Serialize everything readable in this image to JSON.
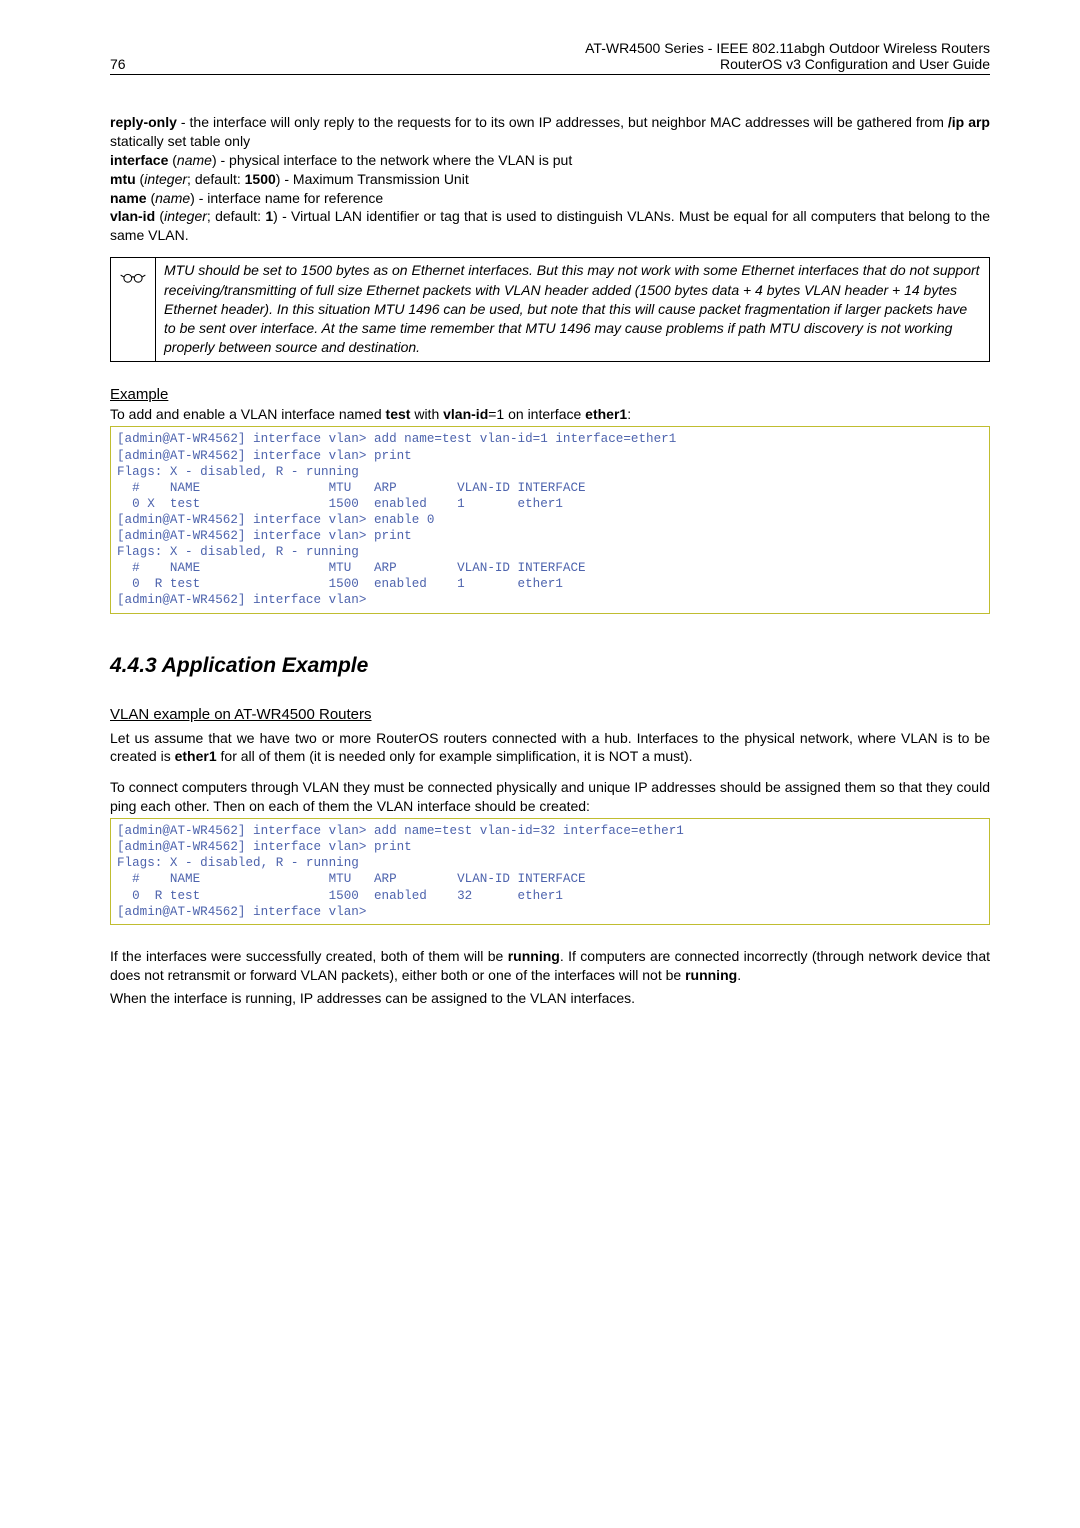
{
  "header": {
    "page_num": "76",
    "title1": "AT-WR4500 Series - IEEE 802.11abgh Outdoor Wireless Routers",
    "title2": "RouterOS v3 Configuration and User Guide"
  },
  "defs": {
    "reply_only_label": "reply-only",
    "reply_only_text": " - the interface will only reply to the requests for to its own IP addresses, but neighbor MAC addresses will be gathered from ",
    "reply_only_cmd": "/ip arp",
    "reply_only_tail": " statically set table only",
    "interface_label": "interface",
    "interface_type": "name",
    "interface_text": ") - physical interface to the network where the VLAN is put",
    "mtu_label": "mtu",
    "mtu_type": "integer",
    "mtu_default": "1500",
    "mtu_text": ") - Maximum Transmission Unit",
    "name_label": "name",
    "name_type": "name",
    "name_text": ") - interface name for reference",
    "vlanid_label": "vlan-id",
    "vlanid_type": "integer",
    "vlanid_default": "1",
    "vlanid_text": ") - Virtual LAN identifier or tag that is used to distinguish VLANs. Must be equal for all computers that belong to the same VLAN."
  },
  "note": {
    "text": "MTU should be set to 1500 bytes as on Ethernet interfaces. But this may not work with some Ethernet interfaces that do not support receiving/transmitting of full size Ethernet packets with VLAN header added (1500 bytes data + 4 bytes VLAN header + 14 bytes Ethernet header). In this situation MTU 1496 can be used, but note that this will cause packet fragmentation if larger packets have to be sent over interface. At the same time remember that MTU 1496 may cause problems if path MTU discovery is not working properly between source and destination."
  },
  "example": {
    "heading": "Example",
    "intro_pre": "To add and enable a VLAN interface named ",
    "intro_name": "test",
    "intro_mid": " with ",
    "intro_vlan": "vlan-id",
    "intro_eq": "=1 on interface ",
    "intro_iface": "ether1",
    "intro_colon": ":",
    "code": "[admin@AT-WR4562] interface vlan> add name=test vlan-id=1 interface=ether1\n[admin@AT-WR4562] interface vlan> print\nFlags: X - disabled, R - running\n  #    NAME                 MTU   ARP        VLAN-ID INTERFACE\n  0 X  test                 1500  enabled    1       ether1\n[admin@AT-WR4562] interface vlan> enable 0\n[admin@AT-WR4562] interface vlan> print\nFlags: X - disabled, R - running\n  #    NAME                 MTU   ARP        VLAN-ID INTERFACE\n  0  R test                 1500  enabled    1       ether1\n[admin@AT-WR4562] interface vlan>"
  },
  "app_example": {
    "heading": "4.4.3 Application Example",
    "sub_heading": "VLAN example on AT-WR4500 Routers",
    "p1a": "Let us assume that we have two or more RouterOS routers connected with a hub. Interfaces to the physical network, where VLAN is to be created is ",
    "p1b": "ether1",
    "p1c": " for all of them (it is needed only for example simplification, it is NOT a must).",
    "p2": "To connect computers through VLAN they must be connected physically and unique IP addresses should be assigned them so that they could ping each other. Then on each of them the VLAN interface should be created:",
    "code": "[admin@AT-WR4562] interface vlan> add name=test vlan-id=32 interface=ether1\n[admin@AT-WR4562] interface vlan> print\nFlags: X - disabled, R - running\n  #    NAME                 MTU   ARP        VLAN-ID INTERFACE\n  0  R test                 1500  enabled    32      ether1\n[admin@AT-WR4562] interface vlan>",
    "p3a": "If the interfaces were successfully created, both of them will be ",
    "p3b": "running",
    "p3c": ". If computers are connected incorrectly (through network device that does not retransmit or forward VLAN packets), either both or one of the interfaces will not be ",
    "p3d": "running",
    "p3e": ".",
    "p4": "When the interface is running, IP addresses can be assigned to the VLAN interfaces."
  }
}
